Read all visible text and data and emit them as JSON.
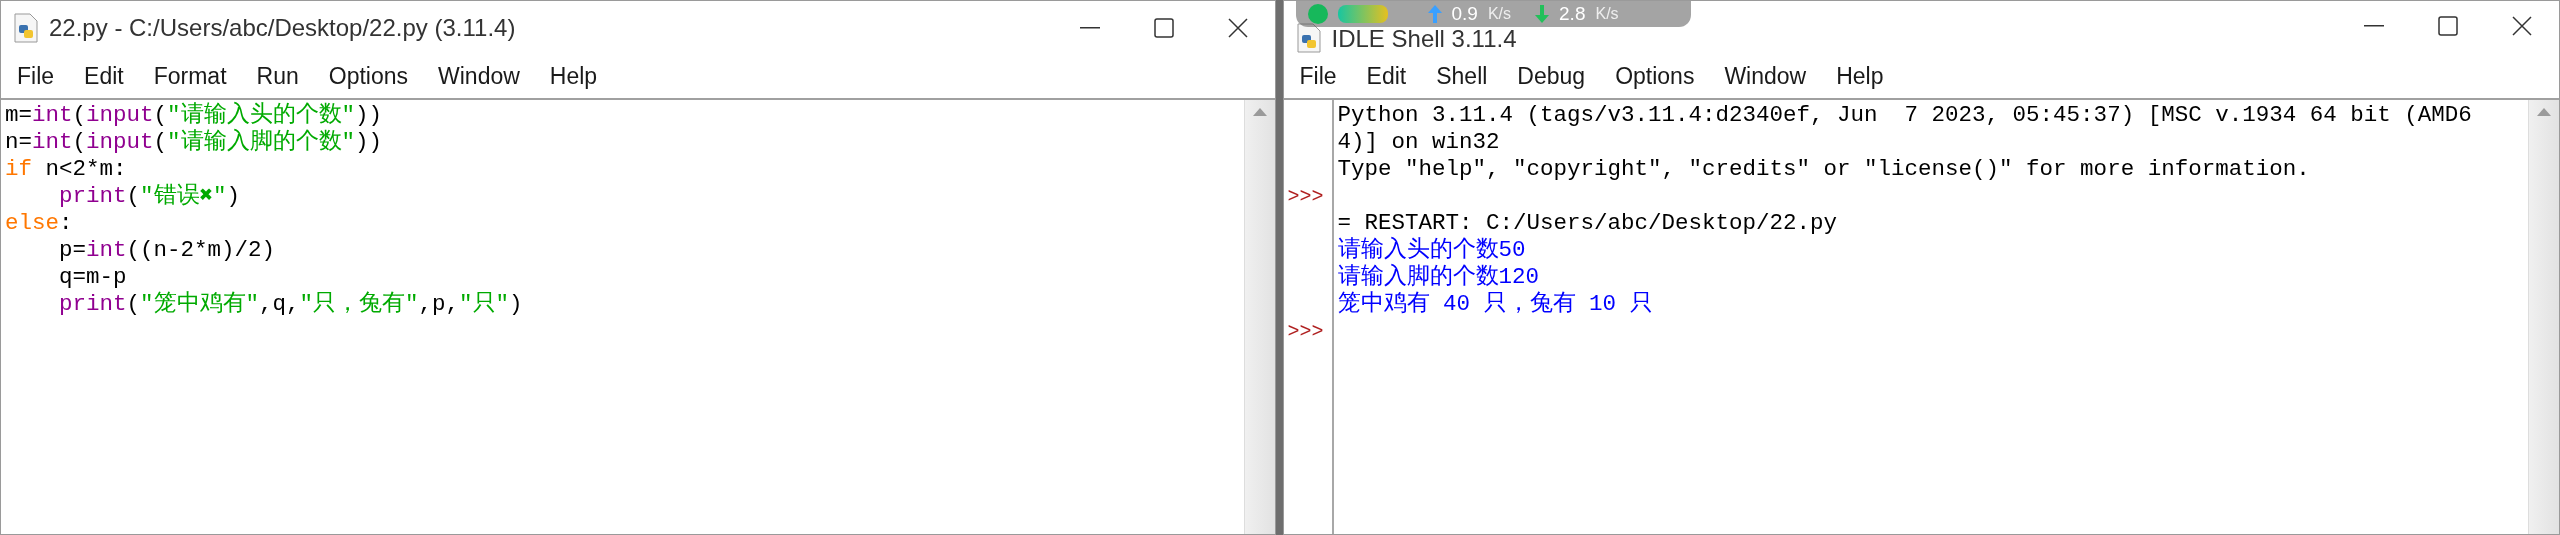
{
  "editor_window": {
    "title": "22.py - C:/Users/abc/Desktop/22.py (3.11.4)",
    "menu": [
      "File",
      "Edit",
      "Format",
      "Run",
      "Options",
      "Window",
      "Help"
    ],
    "code_lines": [
      {
        "indented": false,
        "tokens": [
          {
            "t": "m=",
            "kind": "plain"
          },
          {
            "t": "int",
            "kind": "builtin"
          },
          {
            "t": "(",
            "kind": "plain"
          },
          {
            "t": "input",
            "kind": "builtin"
          },
          {
            "t": "(",
            "kind": "plain"
          },
          {
            "t": "\"请输入头的个数\"",
            "kind": "string"
          },
          {
            "t": "))",
            "kind": "plain"
          }
        ]
      },
      {
        "indented": false,
        "tokens": [
          {
            "t": "n=",
            "kind": "plain"
          },
          {
            "t": "int",
            "kind": "builtin"
          },
          {
            "t": "(",
            "kind": "plain"
          },
          {
            "t": "input",
            "kind": "builtin"
          },
          {
            "t": "(",
            "kind": "plain"
          },
          {
            "t": "\"请输入脚的个数\"",
            "kind": "string"
          },
          {
            "t": "))",
            "kind": "plain"
          }
        ]
      },
      {
        "indented": false,
        "tokens": [
          {
            "t": "if",
            "kind": "keyword"
          },
          {
            "t": " n<2*m:",
            "kind": "plain"
          }
        ]
      },
      {
        "indented": true,
        "tokens": [
          {
            "t": "print",
            "kind": "builtin"
          },
          {
            "t": "(",
            "kind": "plain"
          },
          {
            "t": "\"错误✖\"",
            "kind": "string"
          },
          {
            "t": ")",
            "kind": "plain"
          }
        ]
      },
      {
        "indented": false,
        "tokens": [
          {
            "t": "else",
            "kind": "keyword"
          },
          {
            "t": ":",
            "kind": "plain"
          }
        ]
      },
      {
        "indented": true,
        "tokens": [
          {
            "t": "p=",
            "kind": "plain"
          },
          {
            "t": "int",
            "kind": "builtin"
          },
          {
            "t": "((n-2*m)/2)",
            "kind": "plain"
          }
        ]
      },
      {
        "indented": true,
        "tokens": [
          {
            "t": "q=m-p",
            "kind": "plain"
          }
        ]
      },
      {
        "indented": true,
        "tokens": [
          {
            "t": "print",
            "kind": "builtin"
          },
          {
            "t": "(",
            "kind": "plain"
          },
          {
            "t": "\"笼中鸡有\"",
            "kind": "string"
          },
          {
            "t": ",q,",
            "kind": "plain"
          },
          {
            "t": "\"只，兔有\"",
            "kind": "string"
          },
          {
            "t": ",p,",
            "kind": "plain"
          },
          {
            "t": "\"只\"",
            "kind": "string"
          },
          {
            "t": ")",
            "kind": "plain"
          }
        ]
      }
    ]
  },
  "shell_window": {
    "title": "IDLE Shell 3.11.4",
    "menu": [
      "File",
      "Edit",
      "Shell",
      "Debug",
      "Options",
      "Window",
      "Help"
    ],
    "lines": [
      {
        "text": "Python 3.11.4 (tags/v3.11.4:d2340ef, Jun  7 2023, 05:45:37) [MSC v.1934 64 bit (AMD6",
        "kind": "banner"
      },
      {
        "text": "4)] on win32",
        "kind": "banner"
      },
      {
        "text": "Type \"help\", \"copyright\", \"credits\" or \"license()\" for more information.",
        "kind": "banner"
      },
      {
        "prompt": ">>>"
      },
      {
        "text": "= RESTART: C:/Users/abc/Desktop/22.py",
        "kind": "banner"
      },
      {
        "text": "请输入头的个数50",
        "kind": "output"
      },
      {
        "text": "请输入脚的个数120",
        "kind": "output"
      },
      {
        "text": "笼中鸡有 40 只，兔有 10 只",
        "kind": "output"
      },
      {
        "prompt": ">>>"
      }
    ]
  },
  "network_overlay": {
    "upload": "0.9",
    "upload_unit": "K/s",
    "download": "2.8",
    "download_unit": "K/s"
  }
}
